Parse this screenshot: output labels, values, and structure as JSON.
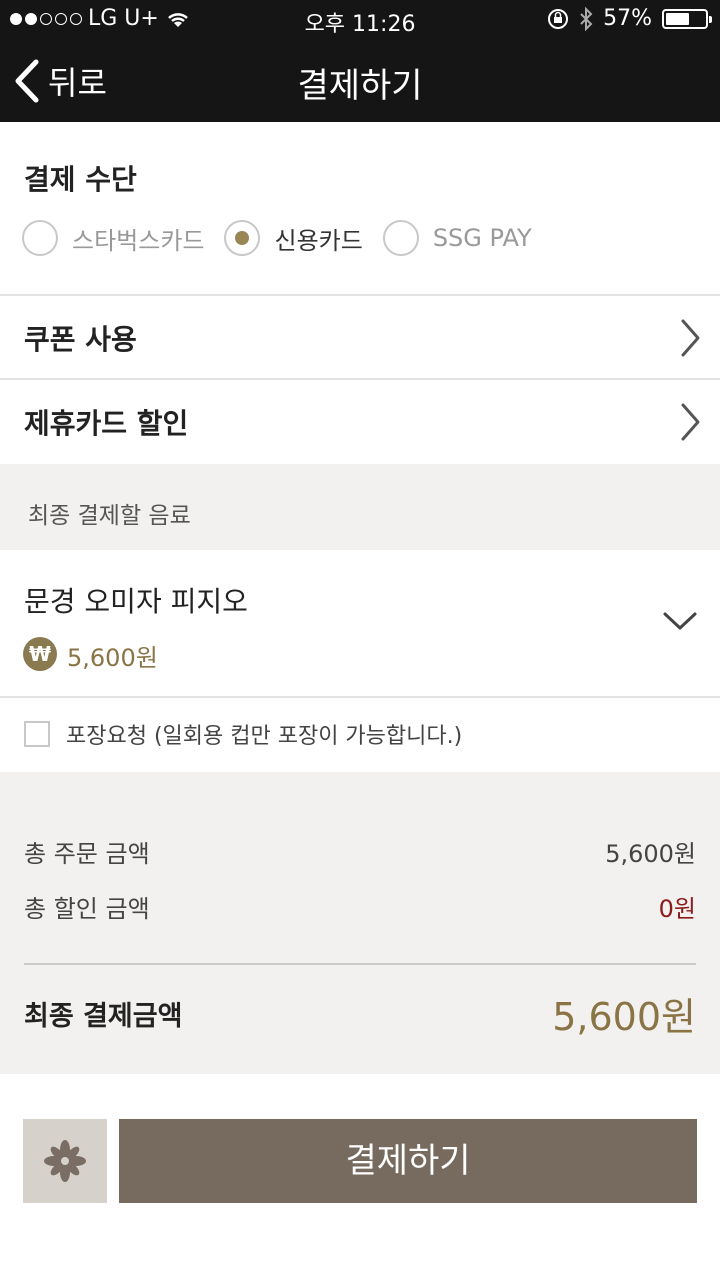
{
  "status_bar": {
    "carrier": "LG U+",
    "time": "오후 11:26",
    "battery": "57%",
    "battery_level": 0.57
  },
  "header": {
    "back_label": "뒤로",
    "title": "결제하기"
  },
  "payment_method": {
    "title": "결제 수단",
    "options": [
      {
        "label": "스타벅스카드",
        "selected": false
      },
      {
        "label": "신용카드",
        "selected": true
      },
      {
        "label": "SSG PAY",
        "selected": false
      }
    ]
  },
  "coupon": {
    "label": "쿠폰 사용"
  },
  "partner_card": {
    "label": "제휴카드 할인"
  },
  "final_drinks_heading": "최종 결제할 음료",
  "drink": {
    "name": "문경 오미자 피지오",
    "currency_symbol": "₩",
    "price": "5,600원"
  },
  "packaging": {
    "label": "포장요청 (일회용 컵만 포장이 가능합니다.)",
    "checked": false
  },
  "summary": {
    "total_order_label": "총 주문 금액",
    "total_order_value": "5,600원",
    "total_discount_label": "총 할인 금액",
    "total_discount_value": "0원",
    "final_label": "최종 결제금액",
    "final_value": "5,600원"
  },
  "footer": {
    "pay_button": "결제하기"
  },
  "colors": {
    "header_bg": "#151515",
    "accent_gold": "#8a7445",
    "discount_red": "#8b1a1a",
    "pay_button_bg": "#776a5f",
    "band_bg": "#f2f1ef"
  }
}
